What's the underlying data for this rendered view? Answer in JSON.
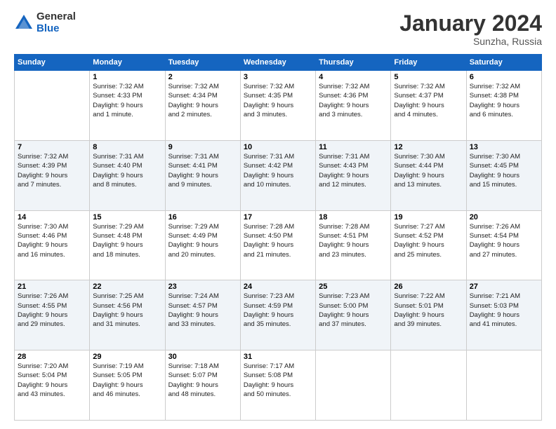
{
  "logo": {
    "general": "General",
    "blue": "Blue"
  },
  "title": "January 2024",
  "subtitle": "Sunzha, Russia",
  "days_of_week": [
    "Sunday",
    "Monday",
    "Tuesday",
    "Wednesday",
    "Thursday",
    "Friday",
    "Saturday"
  ],
  "weeks": [
    [
      {
        "day": "",
        "info": ""
      },
      {
        "day": "1",
        "info": "Sunrise: 7:32 AM\nSunset: 4:33 PM\nDaylight: 9 hours\nand 1 minute."
      },
      {
        "day": "2",
        "info": "Sunrise: 7:32 AM\nSunset: 4:34 PM\nDaylight: 9 hours\nand 2 minutes."
      },
      {
        "day": "3",
        "info": "Sunrise: 7:32 AM\nSunset: 4:35 PM\nDaylight: 9 hours\nand 3 minutes."
      },
      {
        "day": "4",
        "info": "Sunrise: 7:32 AM\nSunset: 4:36 PM\nDaylight: 9 hours\nand 3 minutes."
      },
      {
        "day": "5",
        "info": "Sunrise: 7:32 AM\nSunset: 4:37 PM\nDaylight: 9 hours\nand 4 minutes."
      },
      {
        "day": "6",
        "info": "Sunrise: 7:32 AM\nSunset: 4:38 PM\nDaylight: 9 hours\nand 6 minutes."
      }
    ],
    [
      {
        "day": "7",
        "info": "Sunrise: 7:32 AM\nSunset: 4:39 PM\nDaylight: 9 hours\nand 7 minutes."
      },
      {
        "day": "8",
        "info": "Sunrise: 7:31 AM\nSunset: 4:40 PM\nDaylight: 9 hours\nand 8 minutes."
      },
      {
        "day": "9",
        "info": "Sunrise: 7:31 AM\nSunset: 4:41 PM\nDaylight: 9 hours\nand 9 minutes."
      },
      {
        "day": "10",
        "info": "Sunrise: 7:31 AM\nSunset: 4:42 PM\nDaylight: 9 hours\nand 10 minutes."
      },
      {
        "day": "11",
        "info": "Sunrise: 7:31 AM\nSunset: 4:43 PM\nDaylight: 9 hours\nand 12 minutes."
      },
      {
        "day": "12",
        "info": "Sunrise: 7:30 AM\nSunset: 4:44 PM\nDaylight: 9 hours\nand 13 minutes."
      },
      {
        "day": "13",
        "info": "Sunrise: 7:30 AM\nSunset: 4:45 PM\nDaylight: 9 hours\nand 15 minutes."
      }
    ],
    [
      {
        "day": "14",
        "info": "Sunrise: 7:30 AM\nSunset: 4:46 PM\nDaylight: 9 hours\nand 16 minutes."
      },
      {
        "day": "15",
        "info": "Sunrise: 7:29 AM\nSunset: 4:48 PM\nDaylight: 9 hours\nand 18 minutes."
      },
      {
        "day": "16",
        "info": "Sunrise: 7:29 AM\nSunset: 4:49 PM\nDaylight: 9 hours\nand 20 minutes."
      },
      {
        "day": "17",
        "info": "Sunrise: 7:28 AM\nSunset: 4:50 PM\nDaylight: 9 hours\nand 21 minutes."
      },
      {
        "day": "18",
        "info": "Sunrise: 7:28 AM\nSunset: 4:51 PM\nDaylight: 9 hours\nand 23 minutes."
      },
      {
        "day": "19",
        "info": "Sunrise: 7:27 AM\nSunset: 4:52 PM\nDaylight: 9 hours\nand 25 minutes."
      },
      {
        "day": "20",
        "info": "Sunrise: 7:26 AM\nSunset: 4:54 PM\nDaylight: 9 hours\nand 27 minutes."
      }
    ],
    [
      {
        "day": "21",
        "info": "Sunrise: 7:26 AM\nSunset: 4:55 PM\nDaylight: 9 hours\nand 29 minutes."
      },
      {
        "day": "22",
        "info": "Sunrise: 7:25 AM\nSunset: 4:56 PM\nDaylight: 9 hours\nand 31 minutes."
      },
      {
        "day": "23",
        "info": "Sunrise: 7:24 AM\nSunset: 4:57 PM\nDaylight: 9 hours\nand 33 minutes."
      },
      {
        "day": "24",
        "info": "Sunrise: 7:23 AM\nSunset: 4:59 PM\nDaylight: 9 hours\nand 35 minutes."
      },
      {
        "day": "25",
        "info": "Sunrise: 7:23 AM\nSunset: 5:00 PM\nDaylight: 9 hours\nand 37 minutes."
      },
      {
        "day": "26",
        "info": "Sunrise: 7:22 AM\nSunset: 5:01 PM\nDaylight: 9 hours\nand 39 minutes."
      },
      {
        "day": "27",
        "info": "Sunrise: 7:21 AM\nSunset: 5:03 PM\nDaylight: 9 hours\nand 41 minutes."
      }
    ],
    [
      {
        "day": "28",
        "info": "Sunrise: 7:20 AM\nSunset: 5:04 PM\nDaylight: 9 hours\nand 43 minutes."
      },
      {
        "day": "29",
        "info": "Sunrise: 7:19 AM\nSunset: 5:05 PM\nDaylight: 9 hours\nand 46 minutes."
      },
      {
        "day": "30",
        "info": "Sunrise: 7:18 AM\nSunset: 5:07 PM\nDaylight: 9 hours\nand 48 minutes."
      },
      {
        "day": "31",
        "info": "Sunrise: 7:17 AM\nSunset: 5:08 PM\nDaylight: 9 hours\nand 50 minutes."
      },
      {
        "day": "",
        "info": ""
      },
      {
        "day": "",
        "info": ""
      },
      {
        "day": "",
        "info": ""
      }
    ]
  ]
}
